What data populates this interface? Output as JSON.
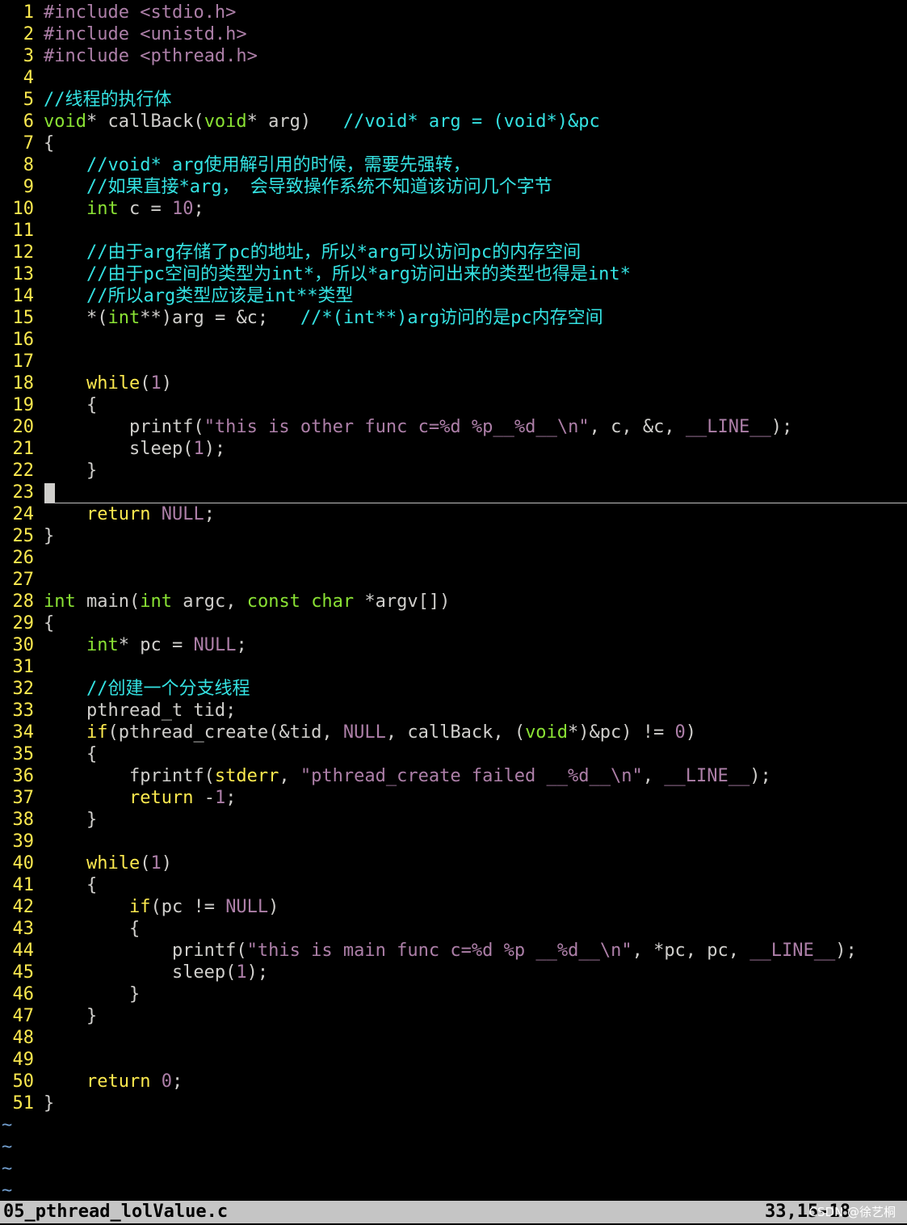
{
  "editor": {
    "lines": [
      {
        "n": "1",
        "parts": [
          [
            "pp",
            "#include "
          ],
          [
            "str",
            "<stdio.h>"
          ]
        ]
      },
      {
        "n": "2",
        "parts": [
          [
            "pp",
            "#include "
          ],
          [
            "str",
            "<unistd.h>"
          ]
        ]
      },
      {
        "n": "3",
        "parts": [
          [
            "pp",
            "#include "
          ],
          [
            "str",
            "<pthread.h>"
          ]
        ]
      },
      {
        "n": "4",
        "parts": []
      },
      {
        "n": "5",
        "parts": [
          [
            "cmt",
            "//线程的执行体"
          ]
        ]
      },
      {
        "n": "6",
        "parts": [
          [
            "ty",
            "void"
          ],
          [
            "",
            "* callBack("
          ],
          [
            "ty",
            "void"
          ],
          [
            "",
            "* arg)   "
          ],
          [
            "cmt",
            "//void* arg = (void*)&pc"
          ]
        ]
      },
      {
        "n": "7",
        "parts": [
          [
            "",
            "{"
          ]
        ]
      },
      {
        "n": "8",
        "parts": [
          [
            "",
            "    "
          ],
          [
            "cmt",
            "//void* arg使用解引用的时候，需要先强转，"
          ]
        ]
      },
      {
        "n": "9",
        "parts": [
          [
            "",
            "    "
          ],
          [
            "cmt",
            "//如果直接*arg， 会导致操作系统不知道该访问几个字节"
          ]
        ]
      },
      {
        "n": "10",
        "parts": [
          [
            "",
            "    "
          ],
          [
            "ty",
            "int"
          ],
          [
            "",
            " c = "
          ],
          [
            "num",
            "10"
          ],
          [
            "",
            ";"
          ]
        ]
      },
      {
        "n": "11",
        "parts": []
      },
      {
        "n": "12",
        "parts": [
          [
            "",
            "    "
          ],
          [
            "cmt",
            "//由于arg存储了pc的地址，所以*arg可以访问pc的内存空间"
          ]
        ]
      },
      {
        "n": "13",
        "parts": [
          [
            "",
            "    "
          ],
          [
            "cmt",
            "//由于pc空间的类型为int*，所以*arg访问出来的类型也得是int*"
          ]
        ]
      },
      {
        "n": "14",
        "parts": [
          [
            "",
            "    "
          ],
          [
            "cmt",
            "//所以arg类型应该是int**类型"
          ]
        ]
      },
      {
        "n": "15",
        "parts": [
          [
            "",
            "    *("
          ],
          [
            "ty",
            "int"
          ],
          [
            "",
            "**)arg = &c;   "
          ],
          [
            "cmt",
            "//*(int**)arg访问的是pc内存空间"
          ]
        ]
      },
      {
        "n": "16",
        "parts": []
      },
      {
        "n": "17",
        "parts": []
      },
      {
        "n": "18",
        "parts": [
          [
            "",
            "    "
          ],
          [
            "kw",
            "while"
          ],
          [
            "",
            "("
          ],
          [
            "num",
            "1"
          ],
          [
            "",
            ")"
          ]
        ]
      },
      {
        "n": "19",
        "parts": [
          [
            "",
            "    {"
          ]
        ]
      },
      {
        "n": "20",
        "parts": [
          [
            "",
            "        printf("
          ],
          [
            "str",
            "\"this is other func c="
          ],
          [
            "spc",
            "%d"
          ],
          [
            "str",
            " "
          ],
          [
            "spc",
            "%p"
          ],
          [
            "str",
            "__"
          ],
          [
            "spc",
            "%d"
          ],
          [
            "str",
            "__"
          ],
          [
            "spc",
            "\\n"
          ],
          [
            "str",
            "\""
          ],
          [
            "",
            ", c, &c, "
          ],
          [
            "pp",
            "__LINE__"
          ],
          [
            "",
            ");"
          ]
        ]
      },
      {
        "n": "21",
        "parts": [
          [
            "",
            "        sleep("
          ],
          [
            "num",
            "1"
          ],
          [
            "",
            ");"
          ]
        ]
      },
      {
        "n": "22",
        "parts": [
          [
            "",
            "    }"
          ]
        ]
      },
      {
        "n": "23",
        "parts": [],
        "cursor": true
      },
      {
        "n": "24",
        "parts": [
          [
            "",
            "    "
          ],
          [
            "kw",
            "return"
          ],
          [
            "pp",
            " NULL"
          ],
          [
            "",
            ";"
          ]
        ]
      },
      {
        "n": "25",
        "parts": [
          [
            "",
            "}"
          ]
        ]
      },
      {
        "n": "26",
        "parts": []
      },
      {
        "n": "27",
        "parts": []
      },
      {
        "n": "28",
        "parts": [
          [
            "ty",
            "int"
          ],
          [
            "",
            " main("
          ],
          [
            "ty",
            "int"
          ],
          [
            "",
            " argc, "
          ],
          [
            "ty",
            "const"
          ],
          [
            "",
            " "
          ],
          [
            "ty",
            "char"
          ],
          [
            "",
            " *argv[])"
          ]
        ]
      },
      {
        "n": "29",
        "parts": [
          [
            "",
            "{"
          ]
        ]
      },
      {
        "n": "30",
        "parts": [
          [
            "",
            "    "
          ],
          [
            "ty",
            "int"
          ],
          [
            "",
            "* pc = "
          ],
          [
            "pp",
            "NULL"
          ],
          [
            "",
            ";"
          ]
        ]
      },
      {
        "n": "31",
        "parts": []
      },
      {
        "n": "32",
        "parts": [
          [
            "",
            "    "
          ],
          [
            "cmt",
            "//创建一个分支线程"
          ]
        ]
      },
      {
        "n": "33",
        "parts": [
          [
            "",
            "    pthread_t tid;"
          ]
        ]
      },
      {
        "n": "34",
        "parts": [
          [
            "",
            "    "
          ],
          [
            "kw",
            "if"
          ],
          [
            "",
            "(pthread_create(&tid, "
          ],
          [
            "pp",
            "NULL"
          ],
          [
            "",
            ", callBack, ("
          ],
          [
            "ty",
            "void"
          ],
          [
            "",
            "*)&pc) != "
          ],
          [
            "num",
            "0"
          ],
          [
            "",
            ")"
          ]
        ]
      },
      {
        "n": "35",
        "parts": [
          [
            "",
            "    {"
          ]
        ]
      },
      {
        "n": "36",
        "parts": [
          [
            "",
            "        fprintf("
          ],
          [
            "kw",
            "stderr"
          ],
          [
            "",
            ", "
          ],
          [
            "str",
            "\"pthread_create failed __"
          ],
          [
            "spc",
            "%d"
          ],
          [
            "str",
            "__"
          ],
          [
            "spc",
            "\\n"
          ],
          [
            "str",
            "\""
          ],
          [
            "",
            ", "
          ],
          [
            "pp",
            "__LINE__"
          ],
          [
            "",
            ");"
          ]
        ]
      },
      {
        "n": "37",
        "parts": [
          [
            "",
            "        "
          ],
          [
            "kw",
            "return"
          ],
          [
            "",
            " -"
          ],
          [
            "num",
            "1"
          ],
          [
            "",
            ";"
          ]
        ]
      },
      {
        "n": "38",
        "parts": [
          [
            "",
            "    }"
          ]
        ]
      },
      {
        "n": "39",
        "parts": []
      },
      {
        "n": "40",
        "parts": [
          [
            "",
            "    "
          ],
          [
            "kw",
            "while"
          ],
          [
            "",
            "("
          ],
          [
            "num",
            "1"
          ],
          [
            "",
            ")"
          ]
        ]
      },
      {
        "n": "41",
        "parts": [
          [
            "",
            "    {"
          ]
        ]
      },
      {
        "n": "42",
        "parts": [
          [
            "",
            "        "
          ],
          [
            "kw",
            "if"
          ],
          [
            "",
            "(pc != "
          ],
          [
            "pp",
            "NULL"
          ],
          [
            "",
            ")"
          ]
        ]
      },
      {
        "n": "43",
        "parts": [
          [
            "",
            "        {"
          ]
        ]
      },
      {
        "n": "44",
        "parts": [
          [
            "",
            "            printf("
          ],
          [
            "str",
            "\"this is main func c="
          ],
          [
            "spc",
            "%d"
          ],
          [
            "str",
            " "
          ],
          [
            "spc",
            "%p"
          ],
          [
            "str",
            " __"
          ],
          [
            "spc",
            "%d"
          ],
          [
            "str",
            "__"
          ],
          [
            "spc",
            "\\n"
          ],
          [
            "str",
            "\""
          ],
          [
            "",
            ", *pc, pc, "
          ],
          [
            "pp",
            "__LINE__"
          ],
          [
            "",
            ");"
          ]
        ]
      },
      {
        "n": "45",
        "parts": [
          [
            "",
            "            sleep("
          ],
          [
            "num",
            "1"
          ],
          [
            "",
            ");"
          ]
        ]
      },
      {
        "n": "46",
        "parts": [
          [
            "",
            "        }"
          ]
        ]
      },
      {
        "n": "47",
        "parts": [
          [
            "",
            "    }"
          ]
        ]
      },
      {
        "n": "48",
        "parts": []
      },
      {
        "n": "49",
        "parts": []
      },
      {
        "n": "50",
        "parts": [
          [
            "",
            "    "
          ],
          [
            "kw",
            "return"
          ],
          [
            "",
            " "
          ],
          [
            "num",
            "0"
          ],
          [
            "",
            ";"
          ]
        ]
      },
      {
        "n": "51",
        "parts": [
          [
            "",
            "}"
          ]
        ]
      }
    ],
    "tildes": [
      "~",
      "~",
      "~",
      "~"
    ]
  },
  "statusbar": {
    "filename": "05_pthread_lolValue.c",
    "position": "33,15-18",
    "watermark": "CSDN @徐艺桐"
  },
  "colors": {
    "background": "#000000",
    "line_number": "#fce94f",
    "comment": "#34e2e2",
    "string": "#ad7fa8",
    "type": "#8ae234",
    "keyword": "#fce94f"
  }
}
